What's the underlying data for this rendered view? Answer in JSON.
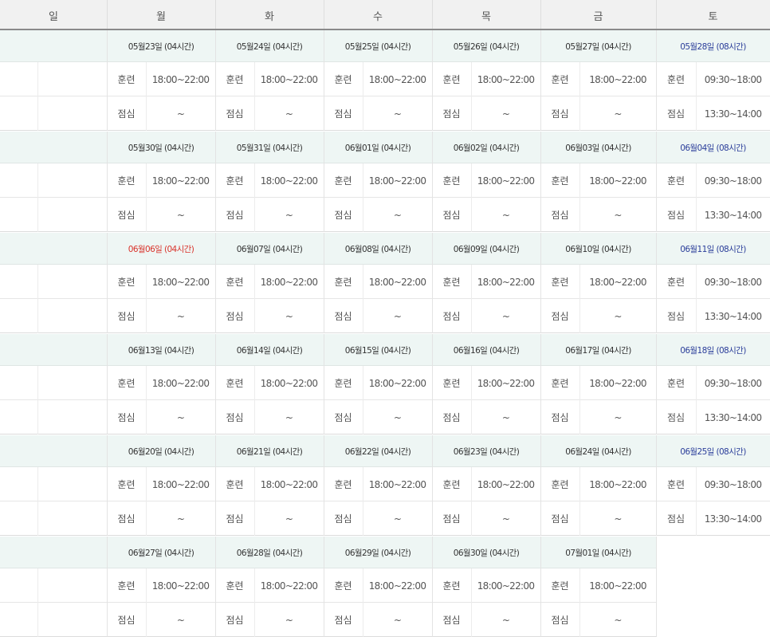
{
  "day_headers": [
    "일",
    "월",
    "화",
    "수",
    "목",
    "금",
    "토"
  ],
  "labels": {
    "training": "훈련",
    "lunch": "점심"
  },
  "colors": {
    "date_text": "#333333",
    "saturday_text": "#2b3e9a",
    "holiday_text": "#d9332b",
    "date_row_bg": "#eef6f4",
    "header_bg": "#f1f1f1"
  },
  "weeks": [
    {
      "days": [
        {
          "date": "05월23일 (04시간)",
          "training": "18:00~22:00",
          "lunch": "~"
        },
        {
          "date": "05월24일 (04시간)",
          "training": "18:00~22:00",
          "lunch": "~"
        },
        {
          "date": "05월25일 (04시간)",
          "training": "18:00~22:00",
          "lunch": "~"
        },
        {
          "date": "05월26일 (04시간)",
          "training": "18:00~22:00",
          "lunch": "~"
        },
        {
          "date": "05월27일 (04시간)",
          "training": "18:00~22:00",
          "lunch": "~"
        },
        {
          "date": "05월28일 (08시간)",
          "training": "09:30~18:00",
          "lunch": "13:30~14:00",
          "type": "saturday"
        }
      ]
    },
    {
      "days": [
        {
          "date": "05월30일 (04시간)",
          "training": "18:00~22:00",
          "lunch": "~"
        },
        {
          "date": "05월31일 (04시간)",
          "training": "18:00~22:00",
          "lunch": "~"
        },
        {
          "date": "06월01일 (04시간)",
          "training": "18:00~22:00",
          "lunch": "~"
        },
        {
          "date": "06월02일 (04시간)",
          "training": "18:00~22:00",
          "lunch": "~"
        },
        {
          "date": "06월03일 (04시간)",
          "training": "18:00~22:00",
          "lunch": "~"
        },
        {
          "date": "06월04일 (08시간)",
          "training": "09:30~18:00",
          "lunch": "13:30~14:00",
          "type": "saturday"
        }
      ]
    },
    {
      "days": [
        {
          "date": "06월06일 (04시간)",
          "training": "18:00~22:00",
          "lunch": "~",
          "type": "holiday"
        },
        {
          "date": "06월07일 (04시간)",
          "training": "18:00~22:00",
          "lunch": "~"
        },
        {
          "date": "06월08일 (04시간)",
          "training": "18:00~22:00",
          "lunch": "~"
        },
        {
          "date": "06월09일 (04시간)",
          "training": "18:00~22:00",
          "lunch": "~"
        },
        {
          "date": "06월10일 (04시간)",
          "training": "18:00~22:00",
          "lunch": "~"
        },
        {
          "date": "06월11일 (08시간)",
          "training": "09:30~18:00",
          "lunch": "13:30~14:00",
          "type": "saturday"
        }
      ]
    },
    {
      "days": [
        {
          "date": "06월13일 (04시간)",
          "training": "18:00~22:00",
          "lunch": "~"
        },
        {
          "date": "06월14일 (04시간)",
          "training": "18:00~22:00",
          "lunch": "~"
        },
        {
          "date": "06월15일 (04시간)",
          "training": "18:00~22:00",
          "lunch": "~"
        },
        {
          "date": "06월16일 (04시간)",
          "training": "18:00~22:00",
          "lunch": "~"
        },
        {
          "date": "06월17일 (04시간)",
          "training": "18:00~22:00",
          "lunch": "~"
        },
        {
          "date": "06월18일 (08시간)",
          "training": "09:30~18:00",
          "lunch": "13:30~14:00",
          "type": "saturday"
        }
      ]
    },
    {
      "days": [
        {
          "date": "06월20일 (04시간)",
          "training": "18:00~22:00",
          "lunch": "~"
        },
        {
          "date": "06월21일 (04시간)",
          "training": "18:00~22:00",
          "lunch": "~"
        },
        {
          "date": "06월22일 (04시간)",
          "training": "18:00~22:00",
          "lunch": "~"
        },
        {
          "date": "06월23일 (04시간)",
          "training": "18:00~22:00",
          "lunch": "~"
        },
        {
          "date": "06월24일 (04시간)",
          "training": "18:00~22:00",
          "lunch": "~"
        },
        {
          "date": "06월25일 (08시간)",
          "training": "09:30~18:00",
          "lunch": "13:30~14:00",
          "type": "saturday"
        }
      ]
    },
    {
      "days": [
        {
          "date": "06월27일 (04시간)",
          "training": "18:00~22:00",
          "lunch": "~"
        },
        {
          "date": "06월28일 (04시간)",
          "training": "18:00~22:00",
          "lunch": "~"
        },
        {
          "date": "06월29일 (04시간)",
          "training": "18:00~22:00",
          "lunch": "~"
        },
        {
          "date": "06월30일 (04시간)",
          "training": "18:00~22:00",
          "lunch": "~"
        },
        {
          "date": "07월01일 (04시간)",
          "training": "18:00~22:00",
          "lunch": "~"
        }
      ]
    }
  ]
}
